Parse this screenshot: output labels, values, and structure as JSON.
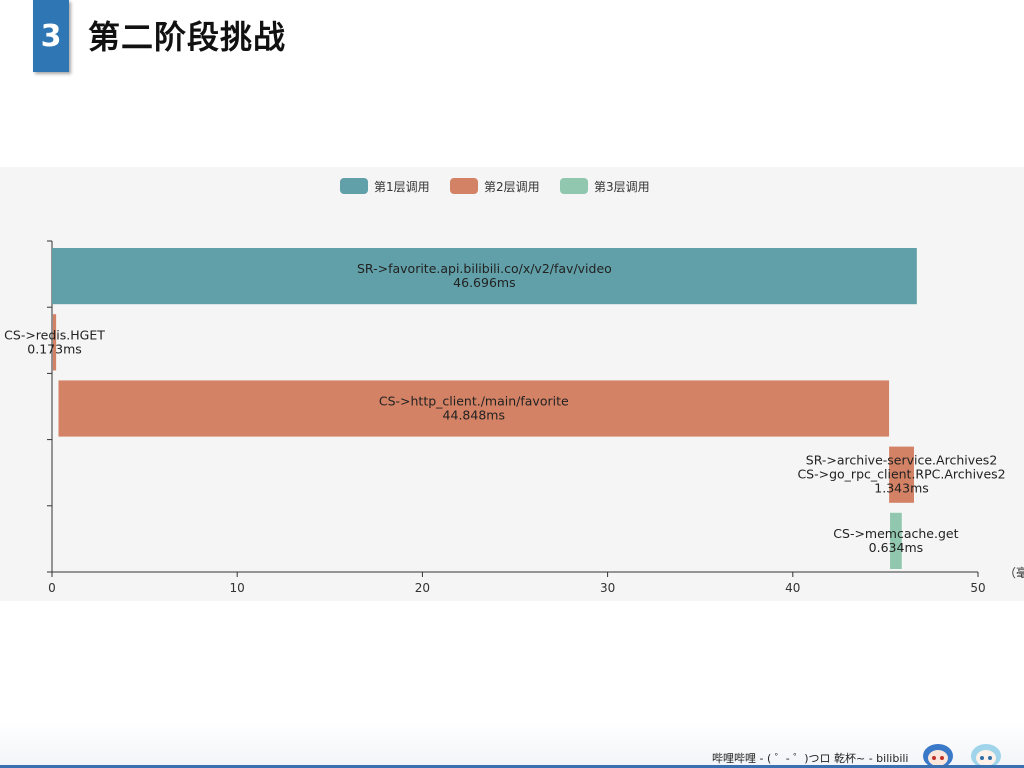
{
  "slide": {
    "number": "3",
    "title": "第二阶段挑战"
  },
  "footer": {
    "text": "哔哩哔哩 - (  ゜- ゜)つロ  乾杯~  - bilibili"
  },
  "colors": {
    "layer1": "#61a0a8",
    "layer2": "#d48265",
    "layer3": "#91c7ae",
    "badge": "#2e77b4",
    "panel": "#f5f5f5"
  },
  "chart_data": {
    "type": "bar",
    "orientation": "horizontal",
    "legend_position": "top-center",
    "legend": [
      {
        "name": "第1层调用",
        "color": "#61a0a8"
      },
      {
        "name": "第2层调用",
        "color": "#d48265"
      },
      {
        "name": "第3层调用",
        "color": "#91c7ae"
      }
    ],
    "xlim": [
      0,
      50
    ],
    "xticks": [
      0,
      10,
      20,
      30,
      40,
      50
    ],
    "xunit_label": "（毫",
    "spans": [
      {
        "layer": 1,
        "start": 0,
        "end": 46.696,
        "label_lines": [
          "SR->favorite.api.bilibili.co/x/v2/fav/video",
          "46.696ms"
        ]
      },
      {
        "layer": 2,
        "start": 0.05,
        "end": 0.223,
        "label_lines": [
          "CS->redis.HGET",
          "0.173ms"
        ]
      },
      {
        "layer": 2,
        "start": 0.35,
        "end": 45.198,
        "label_lines": [
          "CS->http_client./main/favorite",
          "44.848ms"
        ]
      },
      {
        "layer": 2,
        "start": 45.2,
        "end": 46.543,
        "label_lines": [
          "SR->archive-service.Archives2",
          "CS->go_rpc_client.RPC.Archives2",
          "1.343ms"
        ]
      },
      {
        "layer": 3,
        "start": 45.25,
        "end": 45.884,
        "label_lines": [
          "CS->memcache.get",
          "0.634ms"
        ]
      }
    ]
  }
}
